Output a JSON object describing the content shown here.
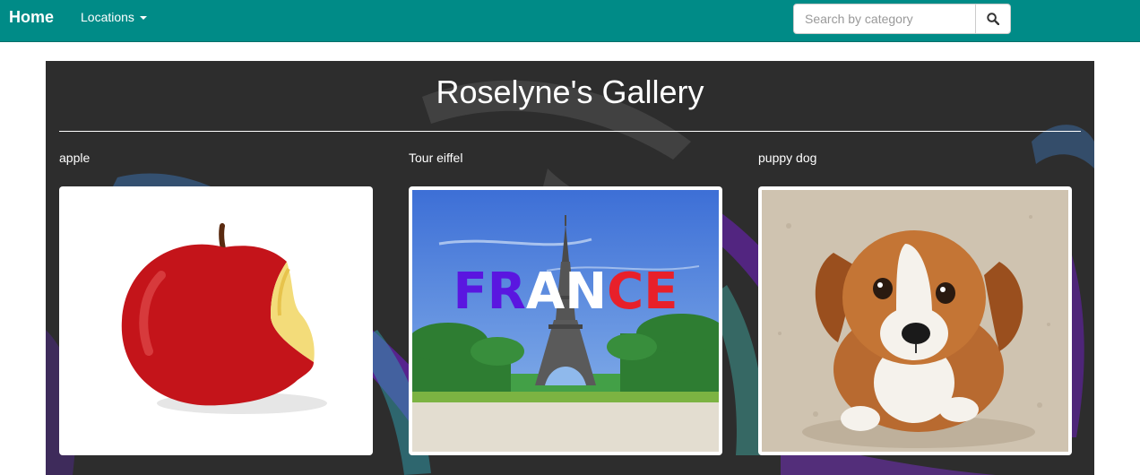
{
  "navbar": {
    "brand": "Home",
    "locations_label": "Locations",
    "search_placeholder": "Search by category",
    "search_value": ""
  },
  "gallery": {
    "title": "Roselyne's Gallery",
    "items": [
      {
        "caption": "apple",
        "image": "red apple with a bite taken out"
      },
      {
        "caption": "Tour eiffel",
        "image": "Eiffel Tower with FRANCE text",
        "image_text": "FRANCE"
      },
      {
        "caption": "puppy dog",
        "image": "brown and white puppy sitting"
      }
    ]
  },
  "colors": {
    "navbar": "#008b87",
    "gallery_bg": "#2b2b2b",
    "accent_purple": "#6a1fb8"
  }
}
